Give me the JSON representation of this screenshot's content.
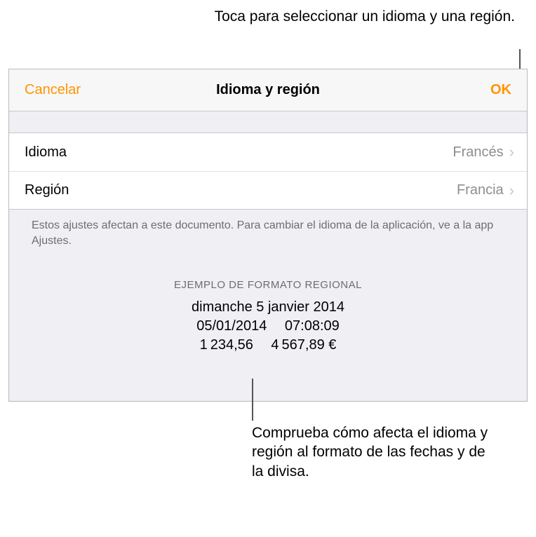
{
  "callouts": {
    "top": "Toca para seleccionar un idioma y una región.",
    "bottom": "Comprueba cómo afecta el idioma y región al formato de las fechas y de la divisa."
  },
  "header": {
    "cancel": "Cancelar",
    "title": "Idioma y región",
    "ok": "OK"
  },
  "rows": {
    "idioma": {
      "label": "Idioma",
      "value": "Francés"
    },
    "region": {
      "label": "Región",
      "value": "Francia"
    }
  },
  "footer_note": "Estos ajustes afectan a este documento. Para cambiar el idioma de la aplicación, ve a la app Ajustes.",
  "example": {
    "header": "EJEMPLO DE FORMATO REGIONAL",
    "line1": "dimanche 5 janvier 2014",
    "line2": "05/01/2014  07:08:09",
    "line3": "1 234,56  4 567,89 €"
  }
}
